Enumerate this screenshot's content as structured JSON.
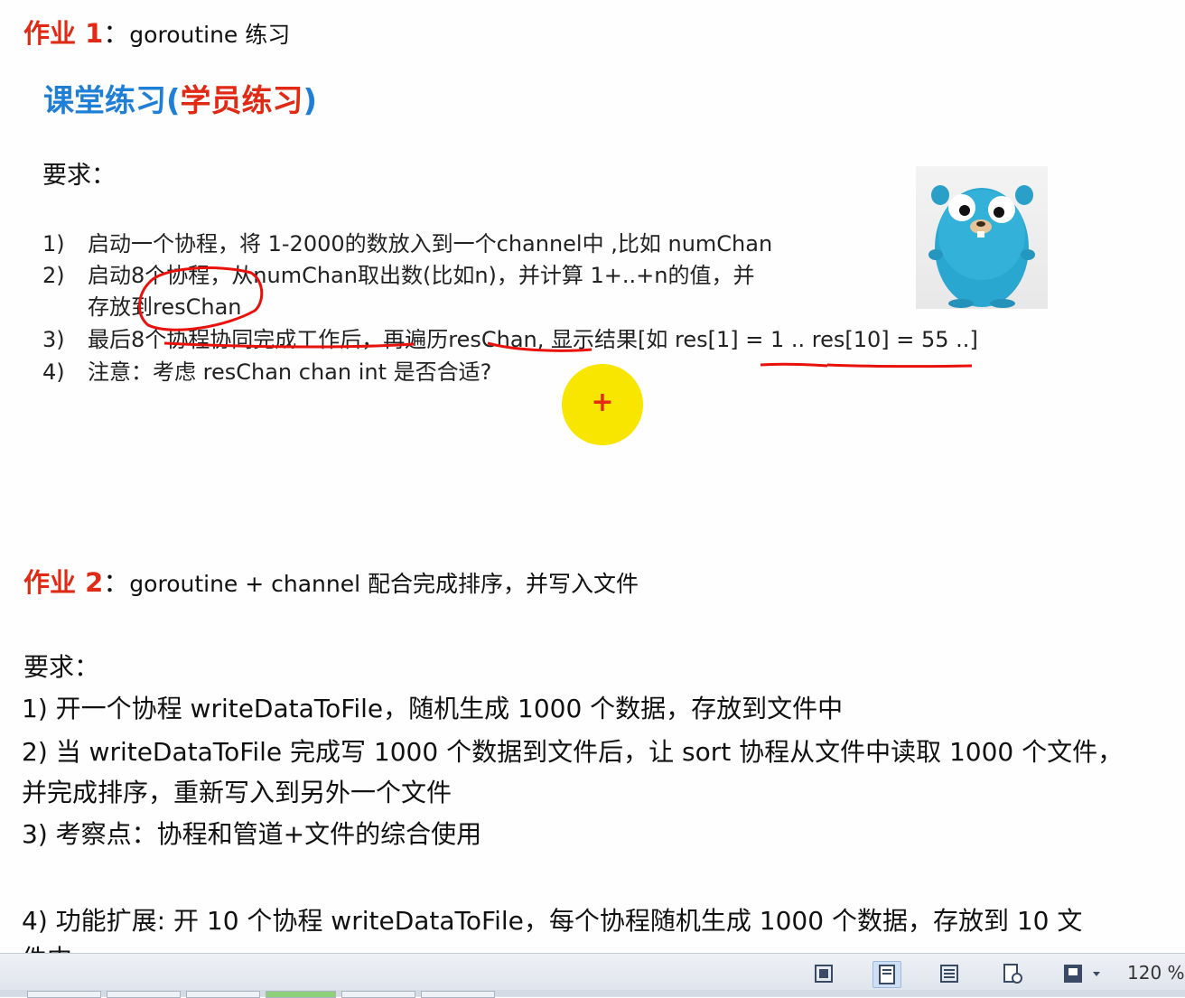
{
  "homework1": {
    "label": "作业 1",
    "colon": "：",
    "title": "goroutine  练习"
  },
  "classwork": {
    "part1": "课堂练习(",
    "part2": "学员练习",
    "part3": ")"
  },
  "requirements1": {
    "label": "要求：",
    "items": [
      {
        "num": "1)",
        "text": "启动一个协程，将 1-2000的数放入到一个channel中 ,比如 numChan"
      },
      {
        "num": "2)",
        "text": "启动8个协程，从numChan取出数(比如n)，并计算 1+..+n的值，并"
      },
      {
        "num": "",
        "text": "存放到resChan"
      },
      {
        "num": "3)",
        "text": "最后8个协程协同完成工作后，再遍历resChan, 显示结果[如 res[1] = 1 .. res[10] = 55 ..]"
      },
      {
        "num": "4)",
        "text": "注意：考虑 resChan chan int 是否合适?"
      }
    ]
  },
  "cursor_symbol": "+",
  "homework2": {
    "label": "作业 2",
    "colon": "：",
    "title": "goroutine + channel  配合完成排序，并写入文件"
  },
  "requirements2": {
    "label": "要求：",
    "lines": [
      "1) 开一个协程  writeDataToFile，随机生成  1000 个数据，存放到文件中",
      "2) 当 writeDataToFile  完成写 1000 个数据到文件后，让 sort  协程从文件中读取 1000 个文件，",
      "并完成排序，重新写入到另外一个文件",
      "3) 考察点：协程和管道+文件的综合使用",
      "4) 功能扩展: 开 10 个协程  writeDataToFile，每个协程随机生成  1000 个数据，存放到 10 文",
      "件中"
    ]
  },
  "statusbar": {
    "zoom": "120 %",
    "icons": [
      "fullscreen-icon",
      "print-layout-icon",
      "outline-icon",
      "web-layout-icon",
      "reading-icon"
    ]
  },
  "colors": {
    "red": "#e02a16",
    "blue": "#1f7fd6",
    "cursor_yellow": "#f8e600",
    "annotation_red": "#e8110c"
  }
}
